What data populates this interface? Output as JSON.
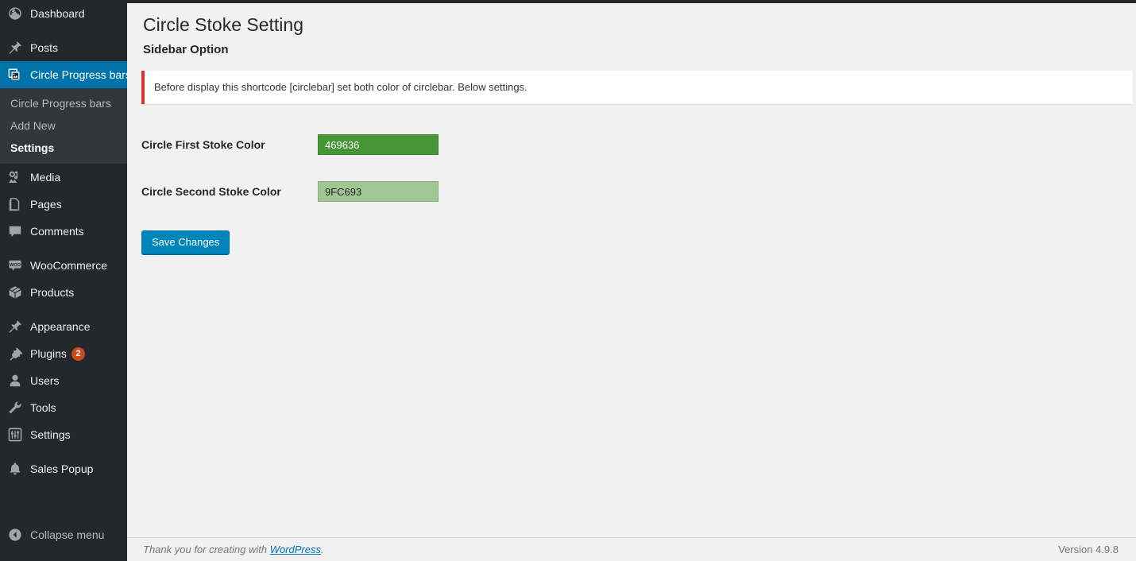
{
  "sidebar": {
    "items": [
      {
        "label": "Dashboard",
        "icon": "dashboard-icon",
        "name": "dashboard",
        "current": false,
        "sep_after": true
      },
      {
        "label": "Posts",
        "icon": "pin-icon",
        "name": "posts",
        "current": false,
        "sep_after": false
      },
      {
        "label": "Circle Progress bars",
        "icon": "gallery-icon",
        "name": "circle-progress-bars",
        "current": true,
        "sep_after": false
      },
      {
        "label": "Media",
        "icon": "media-icon",
        "name": "media",
        "current": false,
        "sep_after": false
      },
      {
        "label": "Pages",
        "icon": "pages-icon",
        "name": "pages",
        "current": false,
        "sep_after": false
      },
      {
        "label": "Comments",
        "icon": "comments-icon",
        "name": "comments",
        "current": false,
        "sep_after": true
      },
      {
        "label": "WooCommerce",
        "icon": "woocommerce-icon",
        "name": "woocommerce",
        "current": false,
        "sep_after": false
      },
      {
        "label": "Products",
        "icon": "products-icon",
        "name": "products",
        "current": false,
        "sep_after": true
      },
      {
        "label": "Appearance",
        "icon": "brush-icon",
        "name": "appearance",
        "current": false,
        "sep_after": false
      },
      {
        "label": "Plugins",
        "icon": "plugins-icon",
        "name": "plugins",
        "current": false,
        "badge": "2",
        "sep_after": false
      },
      {
        "label": "Users",
        "icon": "users-icon",
        "name": "users",
        "current": false,
        "sep_after": false
      },
      {
        "label": "Tools",
        "icon": "tools-icon",
        "name": "tools",
        "current": false,
        "sep_after": false
      },
      {
        "label": "Settings",
        "icon": "settings-icon",
        "name": "settings",
        "current": false,
        "sep_after": true
      },
      {
        "label": "Sales Popup",
        "icon": "bell-icon",
        "name": "sales-popup",
        "current": false,
        "sep_after": false
      }
    ],
    "submenu": [
      {
        "label": "Circle Progress bars",
        "name": "circle-progress-bars",
        "current": false
      },
      {
        "label": "Add New",
        "name": "add-new",
        "current": false
      },
      {
        "label": "Settings",
        "name": "settings",
        "current": true
      }
    ],
    "collapse": {
      "label": "Collapse menu",
      "icon": "collapse-arrow-icon"
    }
  },
  "main": {
    "page_title": "Circle Stoke Setting",
    "section_subtitle": "Sidebar Option",
    "notice": {
      "text": "Before display this shortcode [circlebar] set both color of circlebar. Below settings.",
      "accent_color": "#dc3232"
    },
    "fields": [
      {
        "label": "Circle First Stoke Color",
        "name": "circle-first-stoke-color",
        "value": "469636",
        "background": "#469636",
        "text_color": "#ffffff"
      },
      {
        "label": "Circle Second Stoke Color",
        "name": "circle-second-stoke-color",
        "value": "9FC693",
        "background": "#9FC693",
        "text_color": "#23282d"
      }
    ],
    "save_label": "Save Changes"
  },
  "footer": {
    "thanks_prefix": "Thank you for creating with ",
    "wordpress_link": "WordPress",
    "thanks_suffix": ".",
    "version": "Version 4.9.8"
  }
}
